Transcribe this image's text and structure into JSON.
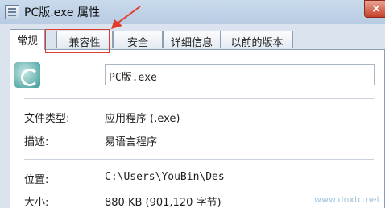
{
  "window": {
    "title": "PC版.exe 属性",
    "close_label": "×"
  },
  "tabs": [
    {
      "label": "常规"
    },
    {
      "label": "兼容性"
    },
    {
      "label": "安全"
    },
    {
      "label": "详细信息"
    },
    {
      "label": "以前的版本"
    }
  ],
  "general": {
    "file_name": "PC版.exe",
    "file_type_label": "文件类型:",
    "file_type_value": "应用程序 (.exe)",
    "description_label": "描述:",
    "description_value": "易语言程序",
    "location_label": "位置:",
    "location_value": "C:\\Users\\YouBin\\Des",
    "size_label": "大小:",
    "size_value": "880 KB (901,120 字节)"
  },
  "watermark": {
    "text": "www.dnxtc.net"
  },
  "annotation": {
    "highlight_color": "#e23c2f"
  }
}
